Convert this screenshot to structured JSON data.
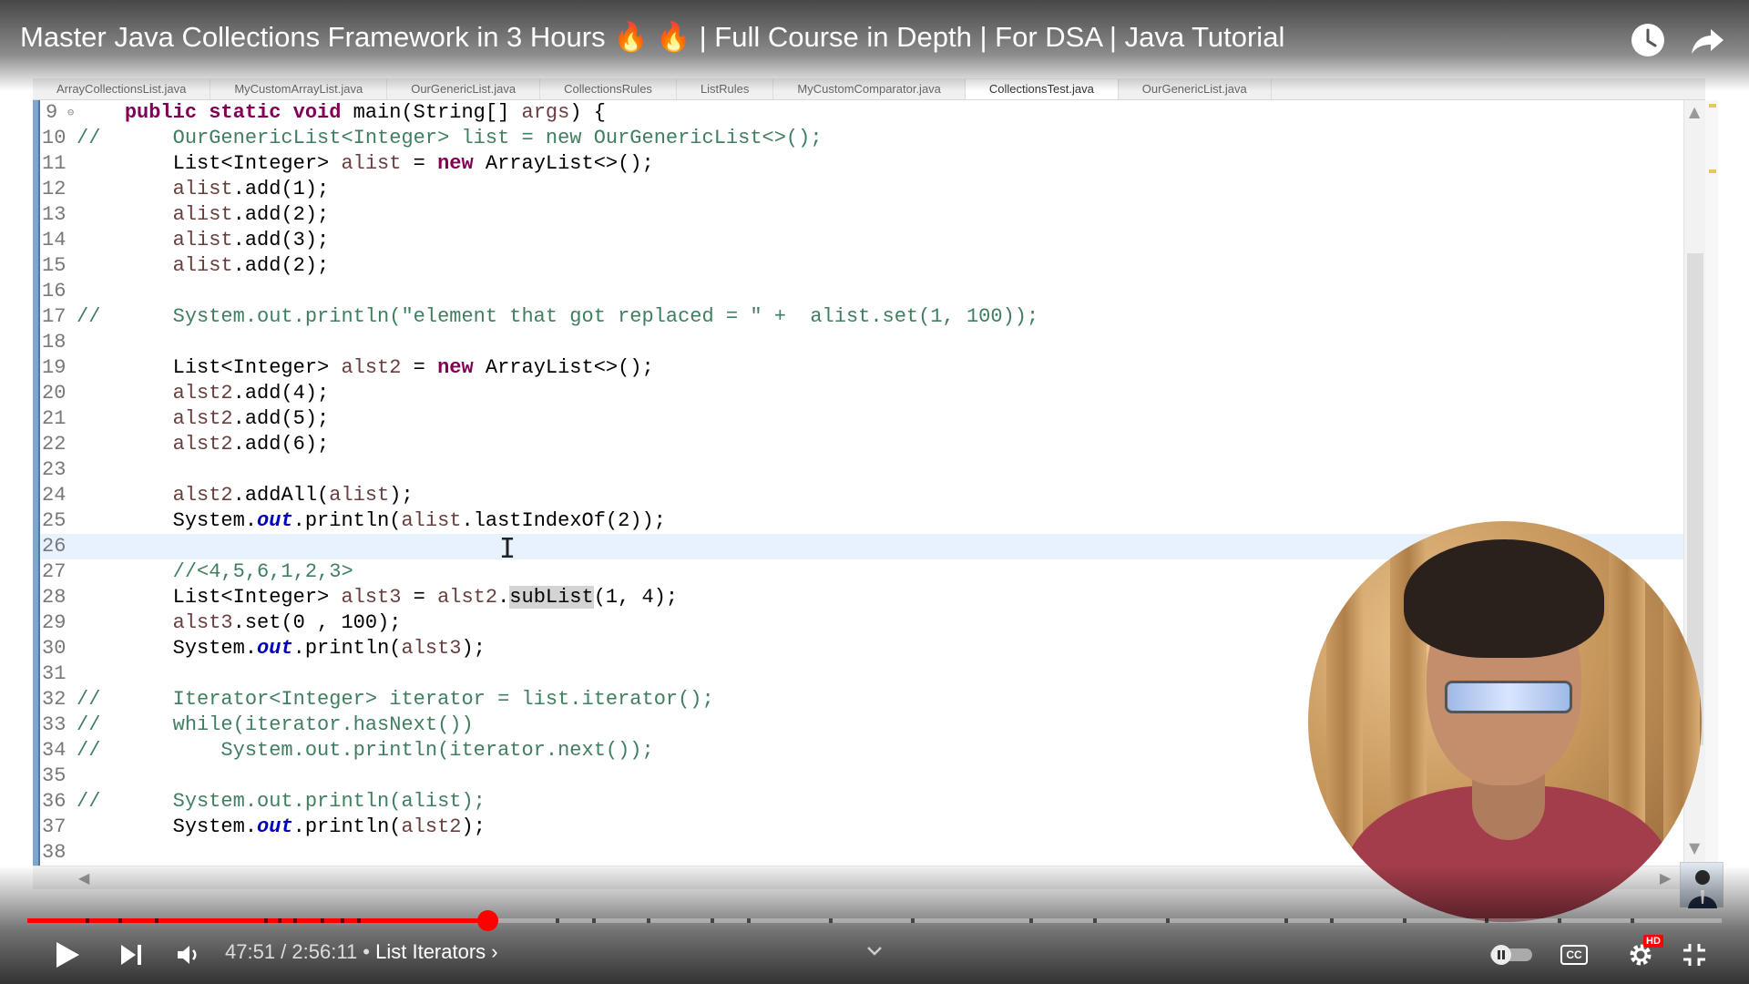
{
  "video": {
    "title": "Master Java Collections Framework in 3 Hours 🔥 🔥 | Full Course in Depth | For DSA | Java Tutorial"
  },
  "ide": {
    "tabs": [
      "ArrayCollectionsList.java",
      "MyCustomArrayList.java",
      "OurGenericList.java",
      "CollectionsRules",
      "ListRules",
      "MyCustomComparator.java",
      "CollectionsTest.java",
      "OurGenericList.java"
    ],
    "lines": [
      {
        "n": "9",
        "fold": "⊖"
      },
      {
        "n": "10"
      },
      {
        "n": "11"
      },
      {
        "n": "12"
      },
      {
        "n": "13"
      },
      {
        "n": "14"
      },
      {
        "n": "15"
      },
      {
        "n": "16"
      },
      {
        "n": "17"
      },
      {
        "n": "18"
      },
      {
        "n": "19"
      },
      {
        "n": "20"
      },
      {
        "n": "21"
      },
      {
        "n": "22"
      },
      {
        "n": "23"
      },
      {
        "n": "24"
      },
      {
        "n": "25"
      },
      {
        "n": "26"
      },
      {
        "n": "27"
      },
      {
        "n": "28"
      },
      {
        "n": "29"
      },
      {
        "n": "30"
      },
      {
        "n": "31"
      },
      {
        "n": "32"
      },
      {
        "n": "33"
      },
      {
        "n": "34"
      },
      {
        "n": "35"
      },
      {
        "n": "36"
      },
      {
        "n": "37"
      },
      {
        "n": "38"
      }
    ],
    "code": {
      "l9": [
        "public static void",
        " main(String[] ",
        "args",
        ") {"
      ],
      "l10": [
        "//      OurGenericList<Integer> list = new OurGenericList<>();"
      ],
      "l11": [
        "        List<Integer> ",
        "alist",
        " = ",
        "new",
        " ArrayList<>();"
      ],
      "l12": [
        "        ",
        "alist",
        ".add(1);"
      ],
      "l13": [
        "        ",
        "alist",
        ".add(2);"
      ],
      "l14": [
        "        ",
        "alist",
        ".add(3);"
      ],
      "l15": [
        "        ",
        "alist",
        ".add(2);"
      ],
      "l17": [
        "//      System.out.println(\"element that got replaced = \" +  alist.set(1, 100));"
      ],
      "l19": [
        "        List<Integer> ",
        "alst2",
        " = ",
        "new",
        " ArrayList<>();"
      ],
      "l20": [
        "        ",
        "alst2",
        ".add(4);"
      ],
      "l21": [
        "        ",
        "alst2",
        ".add(5);"
      ],
      "l22": [
        "        ",
        "alst2",
        ".add(6);"
      ],
      "l24": [
        "        ",
        "alst2",
        ".addAll(",
        "alist",
        ");"
      ],
      "l25": [
        "        System.",
        "out",
        ".println(",
        "alist",
        ".lastIndexOf(2));"
      ],
      "l27": [
        "        //<4,5,6,1,2,3>"
      ],
      "l28": [
        "        List<Integer> ",
        "alst3",
        " = ",
        "alst2",
        ".",
        "subList",
        "(1, 4);"
      ],
      "l29": [
        "        ",
        "alst3",
        ".set(0 , 100);"
      ],
      "l30": [
        "        System.",
        "out",
        ".println(",
        "alst3",
        ");"
      ],
      "l32": [
        "//      Iterator<Integer> iterator = list.iterator();"
      ],
      "l33": [
        "//      while(iterator.hasNext())"
      ],
      "l34": [
        "//          System.out.println(iterator.next());"
      ],
      "l36": [
        "//      System.out.println(alist);"
      ],
      "l37": [
        "        System.",
        "out",
        ".println(",
        "alst2",
        ");"
      ]
    }
  },
  "player": {
    "current_time": "47:51",
    "separator": " / ",
    "duration": "2:56:11",
    "chapter_prefix": " • ",
    "chapter": "List Iterators",
    "chapter_arrow": "›",
    "progress_fraction": 0.2716,
    "cc_label": "CC",
    "hd_badge": "HD",
    "accent_color": "#ff0000"
  },
  "icons": {
    "watch_later": "clock-icon",
    "share": "share-icon",
    "play": "play-icon",
    "next": "next-icon",
    "volume": "volume-icon",
    "chevron": "chevron-down-icon",
    "autoplay": "autoplay-toggle-icon",
    "cc": "captions-icon",
    "settings": "gear-icon",
    "fullscreen_exit": "exit-fullscreen-icon"
  }
}
